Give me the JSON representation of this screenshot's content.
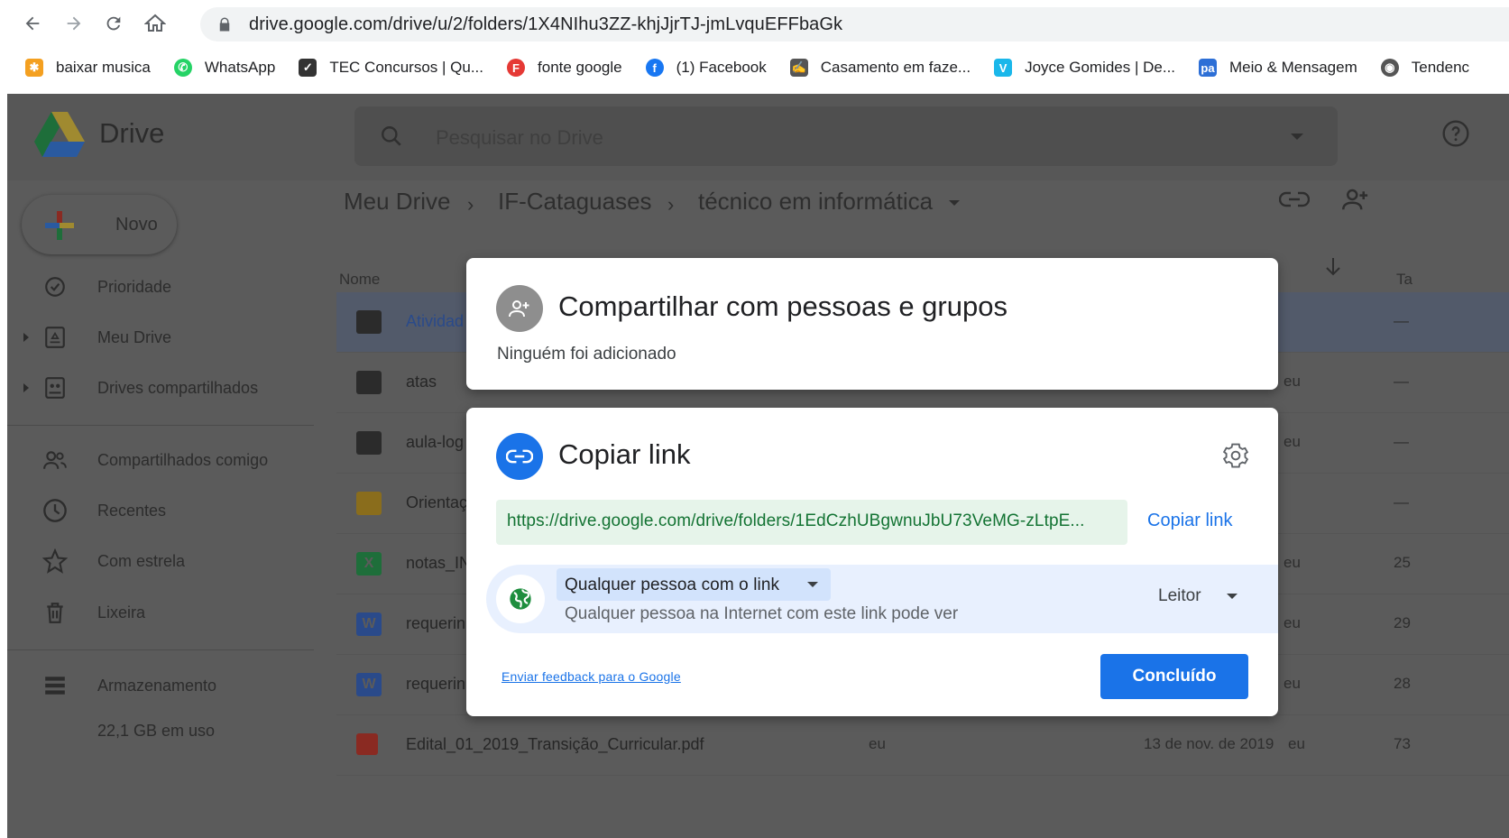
{
  "browser": {
    "url": "drive.google.com/drive/u/2/folders/1X4NIhu3ZZ-khjJjrTJ-jmLvquEFFbaGk",
    "bookmarks": [
      {
        "label": "baixar musica",
        "icon": "burst-icon",
        "color": "#f4a020"
      },
      {
        "label": "WhatsApp",
        "icon": "whatsapp-icon",
        "color": "#25d366"
      },
      {
        "label": "TEC Concursos | Qu...",
        "icon": "checkbox-icon",
        "color": "#333333"
      },
      {
        "label": "fonte google",
        "icon": "f-icon",
        "color": "#e53935"
      },
      {
        "label": "(1) Facebook",
        "icon": "facebook-icon",
        "color": "#1877f2"
      },
      {
        "label": "Casamento em faze...",
        "icon": "signature-icon",
        "color": "#555555"
      },
      {
        "label": "Joyce Gomides | De...",
        "icon": "vimeo-icon",
        "color": "#1ab7ea"
      },
      {
        "label": "Meio & Mensagem",
        "icon": "pa-icon",
        "color": "#2d6fd6"
      },
      {
        "label": "Tendenc",
        "icon": "globe-icon",
        "color": "#555555"
      }
    ]
  },
  "drive": {
    "app_name": "Drive",
    "search_placeholder": "Pesquisar no Drive",
    "new_label": "Novo",
    "sidebar": {
      "items": [
        {
          "label": "Prioridade"
        },
        {
          "label": "Meu Drive"
        },
        {
          "label": "Drives compartilhados"
        },
        {
          "label": "Compartilhados comigo"
        },
        {
          "label": "Recentes"
        },
        {
          "label": "Com estrela"
        },
        {
          "label": "Lixeira"
        },
        {
          "label": "Armazenamento"
        }
      ],
      "storage_used": "22,1 GB em uso"
    },
    "breadcrumb": [
      "Meu Drive",
      "IF-Cataguases",
      "técnico em informática"
    ],
    "columns": {
      "name": "Nome",
      "partial": "Ta"
    },
    "files": [
      {
        "name": "Atividad",
        "type": "shared-folder",
        "owner": "",
        "size": "—"
      },
      {
        "name": "atas",
        "type": "folder",
        "owner": "eu",
        "size": "—"
      },
      {
        "name": "aula-log",
        "type": "folder",
        "owner": "eu",
        "size": "—"
      },
      {
        "name": "Orientaç",
        "type": "slides",
        "owner": "",
        "size": "—"
      },
      {
        "name": "notas_IN",
        "type": "sheet",
        "owner": "eu",
        "size": "25"
      },
      {
        "name": "requerin",
        "type": "word",
        "owner": "eu",
        "size": "29"
      },
      {
        "name": "requerin",
        "type": "word",
        "owner": "eu",
        "size": "28"
      },
      {
        "name": "Edital_01_2019_Transição_Curricular.pdf",
        "type": "pdf",
        "owner": "eu",
        "modified": "13 de nov. de 2019",
        "modified_by": "eu",
        "size": "73"
      }
    ]
  },
  "share_dialog": {
    "title": "Compartilhar com pessoas e grupos",
    "subtitle": "Ninguém foi adicionado"
  },
  "link_dialog": {
    "title": "Copiar link",
    "url": "https://drive.google.com/drive/folders/1EdCzhUBgwnuJbU73VeMG-zLtpE...",
    "copy_label": "Copiar link",
    "access_label": "Qualquer pessoa com o link",
    "access_desc": "Qualquer pessoa na Internet com este link pode ver",
    "role": "Leitor",
    "feedback": "Enviar feedback para o Google",
    "done": "Concluído"
  }
}
